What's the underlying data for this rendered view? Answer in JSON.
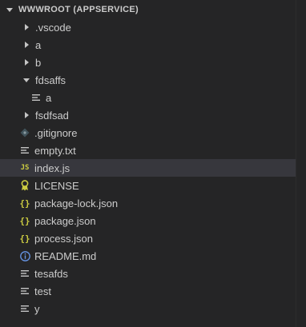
{
  "explorer": {
    "section_title": "WWWROOT (APPSERVICE)"
  },
  "colors": {
    "background": "#252526",
    "selected_row": "#37373d",
    "text": "#cccccc",
    "json_icon": "#cbcb41",
    "js_icon": "#cbcb41",
    "info_icon": "#6796e6",
    "license_icon": "#cbcb41",
    "gitignore_icon": "#41535b"
  },
  "tree": [
    {
      "label": ".vscode",
      "type": "folder",
      "state": "collapsed",
      "depth": 1,
      "icon": "chevron-right-icon"
    },
    {
      "label": "a",
      "type": "folder",
      "state": "collapsed",
      "depth": 1,
      "icon": "chevron-right-icon"
    },
    {
      "label": "b",
      "type": "folder",
      "state": "collapsed",
      "depth": 1,
      "icon": "chevron-right-icon"
    },
    {
      "label": "fdsaffs",
      "type": "folder",
      "state": "expanded",
      "depth": 1,
      "icon": "chevron-down-icon"
    },
    {
      "label": "a",
      "type": "file",
      "depth": 2,
      "icon": "lines-file-icon"
    },
    {
      "label": "fsdfsad",
      "type": "folder",
      "state": "collapsed",
      "depth": 1,
      "icon": "chevron-right-icon"
    },
    {
      "label": ".gitignore",
      "type": "file",
      "depth": 1,
      "icon": "gitignore-icon"
    },
    {
      "label": "empty.txt",
      "type": "file",
      "depth": 1,
      "icon": "lines-file-icon"
    },
    {
      "label": "index.js",
      "type": "file",
      "depth": 1,
      "icon": "js-file-icon",
      "selected": true,
      "icon_text": "JS"
    },
    {
      "label": "LICENSE",
      "type": "file",
      "depth": 1,
      "icon": "license-icon"
    },
    {
      "label": "package-lock.json",
      "type": "file",
      "depth": 1,
      "icon": "json-file-icon",
      "icon_text": "{}"
    },
    {
      "label": "package.json",
      "type": "file",
      "depth": 1,
      "icon": "json-file-icon",
      "icon_text": "{}"
    },
    {
      "label": "process.json",
      "type": "file",
      "depth": 1,
      "icon": "json-file-icon",
      "icon_text": "{}"
    },
    {
      "label": "README.md",
      "type": "file",
      "depth": 1,
      "icon": "info-icon"
    },
    {
      "label": "tesafds",
      "type": "file",
      "depth": 1,
      "icon": "lines-file-icon"
    },
    {
      "label": "test",
      "type": "file",
      "depth": 1,
      "icon": "lines-file-icon"
    },
    {
      "label": "y",
      "type": "file",
      "depth": 1,
      "icon": "lines-file-icon"
    }
  ]
}
